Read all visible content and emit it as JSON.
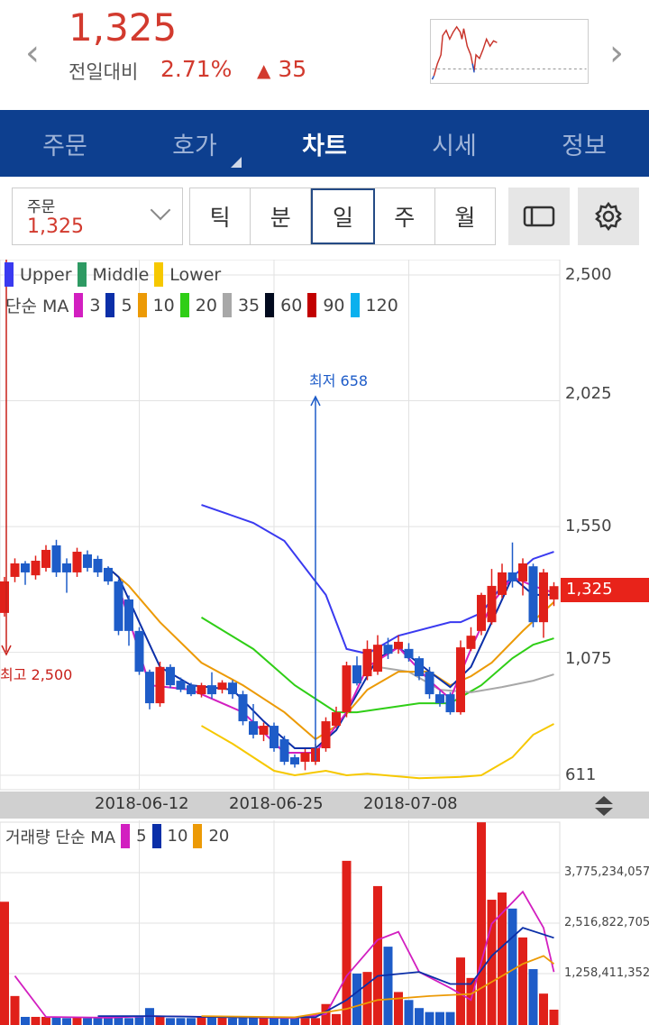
{
  "header": {
    "price": "1,325",
    "compare_label": "전일대비",
    "change_pct": "2.71%",
    "change_arrow": "▲",
    "change_value": "35",
    "prev_icon": "chevron-left",
    "next_icon": "chevron-right"
  },
  "nav": {
    "tabs": [
      "주문",
      "호가",
      "차트",
      "시세",
      "정보"
    ],
    "active": 2
  },
  "toolbar": {
    "order_label": "주문",
    "order_value": "1,325",
    "periods": [
      "틱",
      "분",
      "일",
      "주",
      "월"
    ],
    "active_period": 2
  },
  "legend": {
    "bands": [
      {
        "label": "Upper",
        "color": "#3a3af0"
      },
      {
        "label": "Middle",
        "color": "#2e9a63"
      },
      {
        "label": "Lower",
        "color": "#f6c800"
      }
    ],
    "ma_title": "단순 MA",
    "ma": [
      {
        "label": "3",
        "color": "#d21fc0"
      },
      {
        "label": "5",
        "color": "#0b2fa8"
      },
      {
        "label": "10",
        "color": "#ec9a06"
      },
      {
        "label": "20",
        "color": "#2fce16"
      },
      {
        "label": "35",
        "color": "#a8a8a8"
      },
      {
        "label": "60",
        "color": "#020a1e"
      },
      {
        "label": "90",
        "color": "#c20000"
      },
      {
        "label": "120",
        "color": "#0ab0ee"
      }
    ]
  },
  "volume_legend": {
    "title": "거래량 단순 MA",
    "ma": [
      {
        "label": "5",
        "color": "#d21fc0"
      },
      {
        "label": "10",
        "color": "#0b2fa8"
      },
      {
        "label": "20",
        "color": "#ec9a06"
      }
    ]
  },
  "annotations": {
    "high": "최고 2,500",
    "low": "최저 658"
  },
  "current_price_tag": "1,325",
  "chart_data": {
    "type": "candlestick",
    "price_axis": {
      "ticks": [
        "2,500",
        "2,025",
        "1,550",
        "1,075",
        "611"
      ],
      "tick_values": [
        2500,
        2025,
        1550,
        1075,
        611
      ],
      "range": [
        611,
        2500
      ]
    },
    "date_ticks": [
      {
        "label": "2018-06-12",
        "index": 13
      },
      {
        "label": "2018-06-25",
        "index": 26
      },
      {
        "label": "2018-07-08",
        "index": 39
      }
    ],
    "up_color": "#e0201a",
    "down_color": "#1e5cc8",
    "ohlc": [
      [
        1224,
        1360,
        1210,
        1343
      ],
      [
        1360,
        1430,
        1340,
        1411
      ],
      [
        1411,
        1420,
        1330,
        1377
      ],
      [
        1366,
        1440,
        1350,
        1421
      ],
      [
        1394,
        1480,
        1380,
        1462
      ],
      [
        1479,
        1500,
        1360,
        1377
      ],
      [
        1411,
        1430,
        1300,
        1377
      ],
      [
        1377,
        1470,
        1360,
        1455
      ],
      [
        1445,
        1460,
        1380,
        1394
      ],
      [
        1428,
        1440,
        1360,
        1377
      ],
      [
        1394,
        1400,
        1330,
        1343
      ],
      [
        1343,
        1350,
        1140,
        1156
      ],
      [
        1275,
        1290,
        1100,
        1156
      ],
      [
        1156,
        1170,
        990,
        1002
      ],
      [
        1002,
        1010,
        860,
        883
      ],
      [
        883,
        1040,
        870,
        1020
      ],
      [
        1020,
        1030,
        940,
        951
      ],
      [
        968,
        980,
        925,
        934
      ],
      [
        951,
        960,
        910,
        917
      ],
      [
        917,
        960,
        905,
        951
      ],
      [
        951,
        1000,
        900,
        917
      ],
      [
        934,
        970,
        920,
        961
      ],
      [
        961,
        970,
        900,
        917
      ],
      [
        917,
        930,
        800,
        815
      ],
      [
        815,
        880,
        750,
        764
      ],
      [
        764,
        810,
        740,
        798
      ],
      [
        798,
        810,
        700,
        713
      ],
      [
        747,
        760,
        650,
        662
      ],
      [
        679,
        690,
        640,
        652
      ],
      [
        662,
        710,
        630,
        696
      ],
      [
        662,
        730,
        650,
        713
      ],
      [
        713,
        830,
        700,
        815
      ],
      [
        798,
        870,
        790,
        849
      ],
      [
        849,
        1040,
        830,
        1026
      ],
      [
        1026,
        1060,
        950,
        958
      ],
      [
        985,
        1120,
        970,
        1088
      ],
      [
        1002,
        1140,
        990,
        1104
      ],
      [
        1104,
        1130,
        1050,
        1070
      ],
      [
        1088,
        1140,
        1070,
        1115
      ],
      [
        1088,
        1110,
        1040,
        1053
      ],
      [
        1053,
        1060,
        970,
        985
      ],
      [
        1002,
        1020,
        900,
        917
      ],
      [
        917,
        930,
        870,
        883
      ],
      [
        917,
        925,
        840,
        849
      ],
      [
        849,
        1120,
        840,
        1094
      ],
      [
        1088,
        1170,
        1080,
        1138
      ],
      [
        1156,
        1300,
        1140,
        1292
      ],
      [
        1189,
        1390,
        1180,
        1326
      ],
      [
        1292,
        1410,
        1280,
        1377
      ],
      [
        1377,
        1490,
        1320,
        1343
      ],
      [
        1343,
        1430,
        1290,
        1411
      ],
      [
        1400,
        1410,
        1170,
        1189
      ],
      [
        1189,
        1390,
        1130,
        1377
      ],
      [
        1275,
        1340,
        1250,
        1325
      ]
    ],
    "lines": [
      {
        "name": "Upper",
        "color": "#3a3af0",
        "points": [
          [
            19,
            1632
          ],
          [
            24,
            1564
          ],
          [
            27,
            1496
          ],
          [
            31,
            1292
          ],
          [
            33,
            1088
          ],
          [
            35,
            1070
          ],
          [
            38,
            1138
          ],
          [
            43,
            1189
          ],
          [
            44,
            1189
          ],
          [
            46,
            1224
          ],
          [
            48,
            1326
          ],
          [
            51,
            1428
          ],
          [
            53,
            1455
          ]
        ]
      },
      {
        "name": "MA20",
        "color": "#2fce16",
        "points": [
          [
            19,
            1207
          ],
          [
            24,
            1088
          ],
          [
            28,
            951
          ],
          [
            32,
            849
          ],
          [
            34,
            849
          ],
          [
            37,
            866
          ],
          [
            40,
            883
          ],
          [
            43,
            883
          ],
          [
            46,
            951
          ],
          [
            49,
            1053
          ],
          [
            51,
            1104
          ],
          [
            53,
            1128
          ]
        ]
      },
      {
        "name": "Lower",
        "color": "#f6c800",
        "points": [
          [
            19,
            798
          ],
          [
            22,
            730
          ],
          [
            26,
            628
          ],
          [
            28,
            611
          ],
          [
            31,
            628
          ],
          [
            33,
            611
          ],
          [
            35,
            617
          ],
          [
            40,
            600
          ],
          [
            44,
            605
          ],
          [
            46,
            611
          ],
          [
            49,
            679
          ],
          [
            51,
            764
          ],
          [
            53,
            805
          ]
        ]
      },
      {
        "name": "MA35",
        "color": "#a8a8a8",
        "points": [
          [
            36,
            1020
          ],
          [
            39,
            1002
          ],
          [
            42,
            934
          ],
          [
            45,
            924
          ],
          [
            48,
            944
          ],
          [
            51,
            968
          ],
          [
            53,
            992
          ]
        ]
      },
      {
        "name": "MA10",
        "color": "#ec9a06",
        "points": [
          [
            10,
            1394
          ],
          [
            12,
            1326
          ],
          [
            15,
            1189
          ],
          [
            19,
            1036
          ],
          [
            23,
            951
          ],
          [
            27,
            849
          ],
          [
            30,
            747
          ],
          [
            32,
            798
          ],
          [
            35,
            934
          ],
          [
            38,
            1002
          ],
          [
            41,
            1002
          ],
          [
            43,
            951
          ],
          [
            45,
            985
          ],
          [
            47,
            1036
          ],
          [
            50,
            1156
          ],
          [
            53,
            1265
          ]
        ]
      },
      {
        "name": "MA5",
        "color": "#0b2fa8",
        "points": [
          [
            10,
            1394
          ],
          [
            11,
            1360
          ],
          [
            13,
            1189
          ],
          [
            15,
            1020
          ],
          [
            18,
            951
          ],
          [
            22,
            934
          ],
          [
            25,
            815
          ],
          [
            28,
            713
          ],
          [
            30,
            713
          ],
          [
            32,
            781
          ],
          [
            34,
            917
          ],
          [
            36,
            1053
          ],
          [
            38,
            1094
          ],
          [
            41,
            1002
          ],
          [
            43,
            944
          ],
          [
            45,
            1020
          ],
          [
            47,
            1189
          ],
          [
            49,
            1360
          ],
          [
            51,
            1292
          ],
          [
            53,
            1292
          ]
        ]
      },
      {
        "name": "MA3",
        "color": "#d21fc0",
        "points": [
          [
            11,
            1326
          ],
          [
            14,
            951
          ],
          [
            18,
            934
          ],
          [
            23,
            849
          ],
          [
            27,
            696
          ],
          [
            30,
            696
          ],
          [
            33,
            849
          ],
          [
            35,
            1020
          ],
          [
            38,
            1094
          ],
          [
            41,
            968
          ],
          [
            43,
            900
          ],
          [
            45,
            1088
          ],
          [
            47,
            1258
          ],
          [
            49,
            1360
          ],
          [
            51,
            1326
          ],
          [
            53,
            1300
          ]
        ]
      }
    ],
    "volume_axis": {
      "ticks": [
        "3,775,234,057",
        "2,516,822,705",
        "1,258,411,352"
      ],
      "tick_values": [
        3775234057,
        2516822705,
        1258411352
      ]
    },
    "volume_billions": [
      3.05,
      0.7,
      0.18,
      0.18,
      0.18,
      0.18,
      0.15,
      0.18,
      0.15,
      0.15,
      0.15,
      0.18,
      0.15,
      0.2,
      0.4,
      0.18,
      0.15,
      0.15,
      0.15,
      0.18,
      0.2,
      0.18,
      0.15,
      0.15,
      0.15,
      0.15,
      0.15,
      0.15,
      0.15,
      0.15,
      0.15,
      0.5,
      0.25,
      4.07,
      1.26,
      1.3,
      3.44,
      1.93,
      0.8,
      0.6,
      0.4,
      0.3,
      0.3,
      0.3,
      1.66,
      1.15,
      5.03,
      3.1,
      3.28,
      2.88,
      2.16,
      1.37,
      0.76,
      0.36
    ],
    "volume_lines": [
      {
        "name": "5",
        "color": "#d21fc0",
        "points": [
          [
            1,
            1.2
          ],
          [
            4,
            0.18
          ],
          [
            10,
            0.16
          ],
          [
            14,
            0.2
          ],
          [
            20,
            0.18
          ],
          [
            28,
            0.15
          ],
          [
            31,
            0.25
          ],
          [
            33,
            1.2
          ],
          [
            36,
            2.1
          ],
          [
            38,
            2.3
          ],
          [
            40,
            1.3
          ],
          [
            43,
            0.9
          ],
          [
            45,
            0.6
          ],
          [
            47,
            2.5
          ],
          [
            50,
            3.3
          ],
          [
            52,
            2.4
          ],
          [
            53,
            1.3
          ]
        ]
      },
      {
        "name": "10",
        "color": "#0b2fa8",
        "points": [
          [
            9,
            0.2
          ],
          [
            14,
            0.2
          ],
          [
            22,
            0.17
          ],
          [
            30,
            0.17
          ],
          [
            33,
            0.6
          ],
          [
            36,
            1.2
          ],
          [
            40,
            1.3
          ],
          [
            43,
            1.0
          ],
          [
            45,
            1.0
          ],
          [
            47,
            1.7
          ],
          [
            50,
            2.4
          ],
          [
            53,
            2.15
          ]
        ]
      },
      {
        "name": "20",
        "color": "#ec9a06",
        "points": [
          [
            19,
            0.2
          ],
          [
            28,
            0.17
          ],
          [
            33,
            0.38
          ],
          [
            36,
            0.6
          ],
          [
            41,
            0.7
          ],
          [
            45,
            0.75
          ],
          [
            47,
            1.05
          ],
          [
            50,
            1.5
          ],
          [
            52,
            1.7
          ],
          [
            53,
            1.5
          ]
        ]
      }
    ]
  }
}
